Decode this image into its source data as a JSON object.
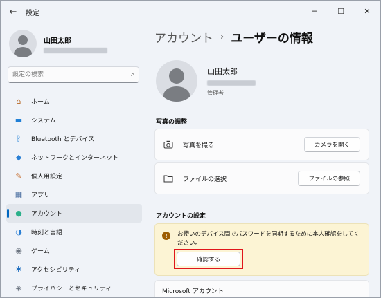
{
  "window": {
    "title": "設定",
    "back_icon": "←",
    "controls": {
      "minimize": "─",
      "maximize": "☐",
      "close": "✕"
    }
  },
  "user": {
    "name": "山田太郎"
  },
  "search": {
    "placeholder": "設定の検索",
    "icon": "⌕"
  },
  "nav": [
    {
      "label": "ホーム",
      "icon": "home-icon",
      "glyph": "⌂",
      "color": "#b86b2a"
    },
    {
      "label": "システム",
      "icon": "system-icon",
      "glyph": "▬",
      "color": "#1f7fd6"
    },
    {
      "label": "Bluetooth とデバイス",
      "icon": "bluetooth-icon",
      "glyph": "ᛒ",
      "color": "#1f7fd6"
    },
    {
      "label": "ネットワークとインターネット",
      "icon": "wifi-icon",
      "glyph": "◆",
      "color": "#2a7fd4"
    },
    {
      "label": "個人用設定",
      "icon": "personalization-icon",
      "glyph": "✎",
      "color": "#c46a2a"
    },
    {
      "label": "アプリ",
      "icon": "apps-icon",
      "glyph": "▦",
      "color": "#4a6ea0"
    },
    {
      "label": "アカウント",
      "icon": "account-icon",
      "glyph": "●",
      "color": "#2bb08a",
      "active": true
    },
    {
      "label": "時刻と言語",
      "icon": "time-language-icon",
      "glyph": "◑",
      "color": "#2a7fd4"
    },
    {
      "label": "ゲーム",
      "icon": "gaming-icon",
      "glyph": "◉",
      "color": "#6b7480"
    },
    {
      "label": "アクセシビリティ",
      "icon": "accessibility-icon",
      "glyph": "✱",
      "color": "#1f6fc0"
    },
    {
      "label": "プライバシーとセキュリティ",
      "icon": "shield-icon",
      "glyph": "◈",
      "color": "#6b7480"
    }
  ],
  "breadcrumb": {
    "parent": "アカウント",
    "separator": "›",
    "current": "ユーザーの情報"
  },
  "profile": {
    "name": "山田太郎",
    "role": "管理者"
  },
  "photo_section": {
    "title": "写真の調整",
    "take_photo": {
      "label": "写真を撮る",
      "button": "カメラを開く"
    },
    "choose_file": {
      "label": "ファイルの選択",
      "button": "ファイルの参照"
    }
  },
  "account_settings": {
    "title": "アカウントの設定",
    "warning": {
      "text": "お使いのデバイス間でパスワードを同期するために本人確認をしてください。",
      "button": "確認する"
    },
    "microsoft_account": {
      "title": "Microsoft アカウント"
    }
  }
}
